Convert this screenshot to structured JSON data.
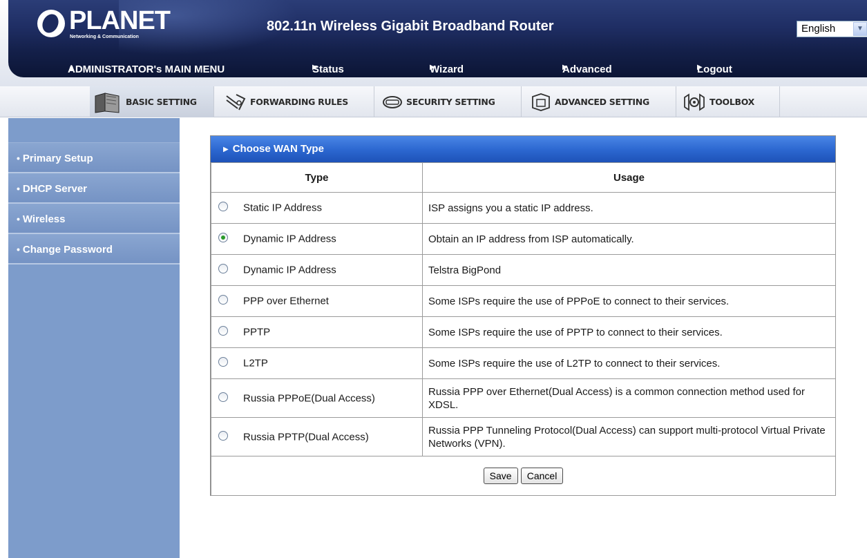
{
  "header": {
    "brand": "PLANET",
    "tagline": "Networking & Communication",
    "title": "802.11n Wireless Gigabit Broadband Router",
    "language": "English"
  },
  "main_menu": {
    "admin": "ADMINISTRATOR's MAIN MENU",
    "items": [
      "Status",
      "Wizard",
      "Advanced",
      "Logout"
    ]
  },
  "tabs": [
    "BASIC SETTING",
    "FORWARDING RULES",
    "SECURITY SETTING",
    "ADVANCED SETTING",
    "TOOLBOX"
  ],
  "sidebar": {
    "items": [
      "Primary Setup",
      "DHCP Server",
      "Wireless",
      "Change Password"
    ]
  },
  "panel": {
    "title": "Choose WAN Type",
    "columns": [
      "Type",
      "Usage"
    ],
    "rows": [
      {
        "type": "Static IP Address",
        "usage": "ISP assigns you a static IP address.",
        "selected": false
      },
      {
        "type": "Dynamic IP Address",
        "usage": "Obtain an IP address from ISP automatically.",
        "selected": true
      },
      {
        "type": "Dynamic IP Address",
        "usage": "Telstra BigPond",
        "selected": false
      },
      {
        "type": "PPP over Ethernet",
        "usage": "Some ISPs require the use of PPPoE to connect to their services.",
        "selected": false
      },
      {
        "type": "PPTP",
        "usage": "Some ISPs require the use of PPTP to connect to their services.",
        "selected": false
      },
      {
        "type": "L2TP",
        "usage": "Some ISPs require the use of L2TP to connect to their services.",
        "selected": false
      },
      {
        "type": "Russia PPPoE(Dual Access)",
        "usage": "Russia PPP over Ethernet(Dual Access) is a common connection method used for XDSL.",
        "selected": false
      },
      {
        "type": "Russia PPTP(Dual Access)",
        "usage": "Russia PPP Tunneling Protocol(Dual Access) can support multi-protocol Virtual Private Networks (VPN).",
        "selected": false
      }
    ],
    "save_label": "Save",
    "cancel_label": "Cancel"
  },
  "colors": {
    "header_bg": "#1f2e64",
    "sidebar_bg": "#7d9ccb",
    "panel_title_bg": "#2b66cf",
    "radio_checked": "#2a9a2a"
  }
}
